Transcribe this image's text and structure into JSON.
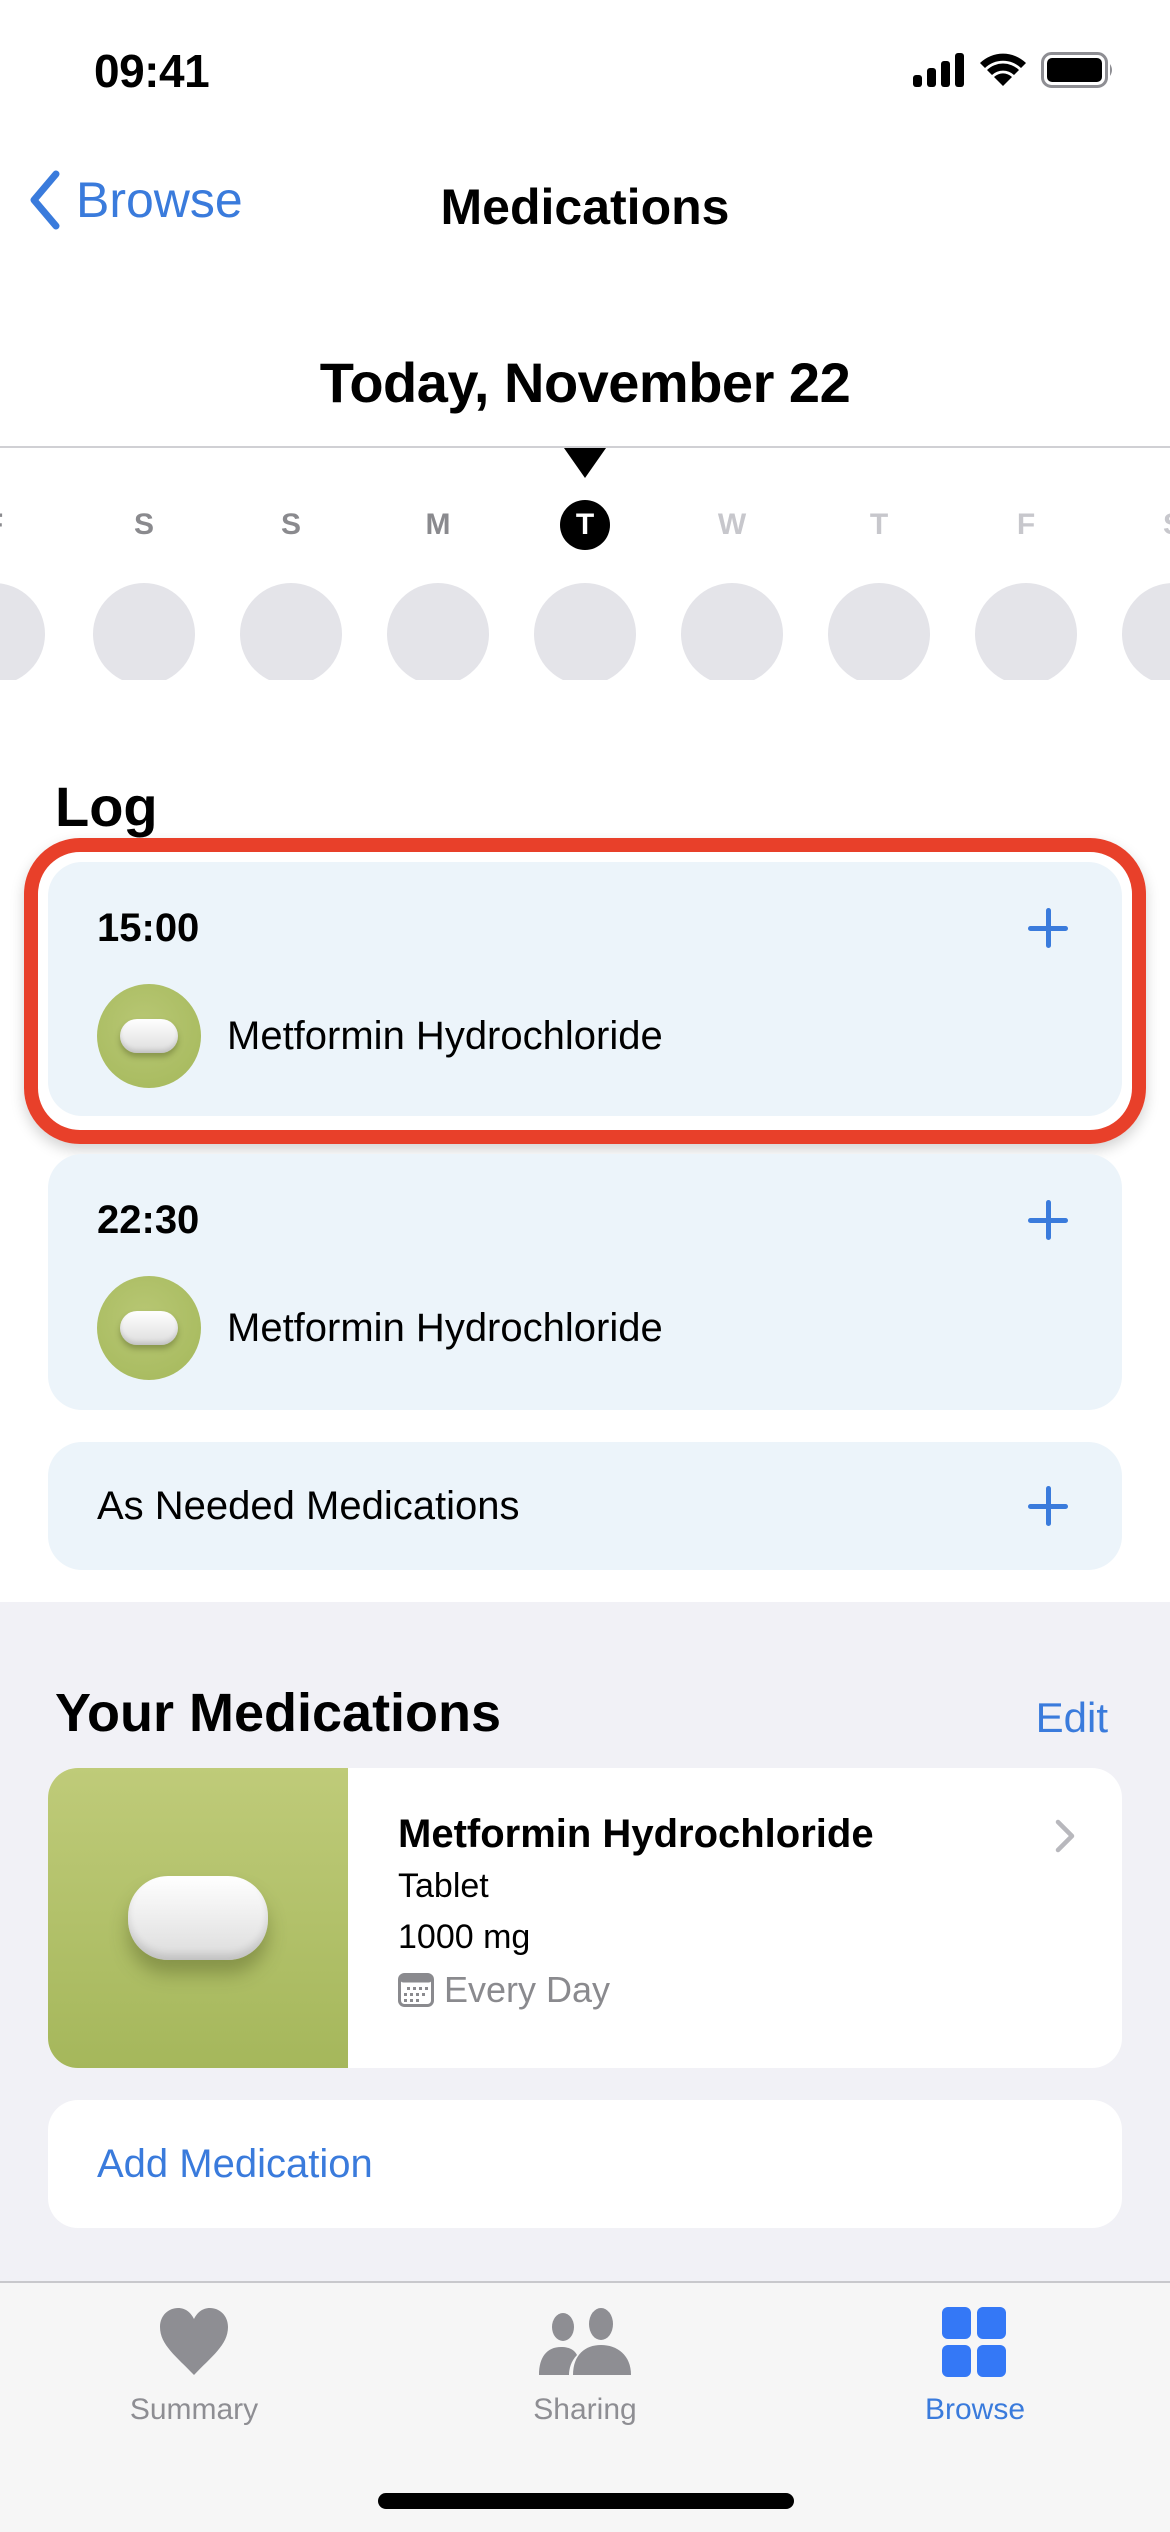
{
  "status_bar": {
    "time": "09:41",
    "icons": [
      "cellular-signal-icon",
      "wifi-icon",
      "battery-icon"
    ]
  },
  "nav": {
    "back_label": "Browse",
    "title": "Medications"
  },
  "date_header": {
    "title": "Today, November 22"
  },
  "week": {
    "days": [
      {
        "letter": "F",
        "state": "past"
      },
      {
        "letter": "S",
        "state": "past"
      },
      {
        "letter": "S",
        "state": "past"
      },
      {
        "letter": "M",
        "state": "past"
      },
      {
        "letter": "T",
        "state": "today"
      },
      {
        "letter": "W",
        "state": "future"
      },
      {
        "letter": "T",
        "state": "future"
      },
      {
        "letter": "F",
        "state": "future"
      },
      {
        "letter": "S",
        "state": "future"
      }
    ]
  },
  "log": {
    "title": "Log",
    "entries": [
      {
        "time": "15:00",
        "medication": "Metformin Hydrochloride",
        "highlighted": true
      },
      {
        "time": "22:30",
        "medication": "Metformin Hydrochloride",
        "highlighted": false
      }
    ],
    "as_needed_label": "As Needed Medications"
  },
  "your_medications": {
    "title": "Your Medications",
    "edit_label": "Edit",
    "items": [
      {
        "name": "Metformin Hydrochloride",
        "form": "Tablet",
        "strength": "1000 mg",
        "schedule": "Every Day",
        "icon": "pill-icon"
      }
    ],
    "add_label": "Add Medication"
  },
  "tab_bar": {
    "tabs": [
      {
        "label": "Summary",
        "icon": "heart-icon",
        "active": false
      },
      {
        "label": "Sharing",
        "icon": "people-icon",
        "active": false
      },
      {
        "label": "Browse",
        "icon": "grid-icon",
        "active": true
      }
    ]
  },
  "colors": {
    "accent": "#3a7bdc",
    "highlight_outline": "#e8402a",
    "log_card_bg": "#ecf4fa",
    "pill_green": "#a9bb5f"
  }
}
